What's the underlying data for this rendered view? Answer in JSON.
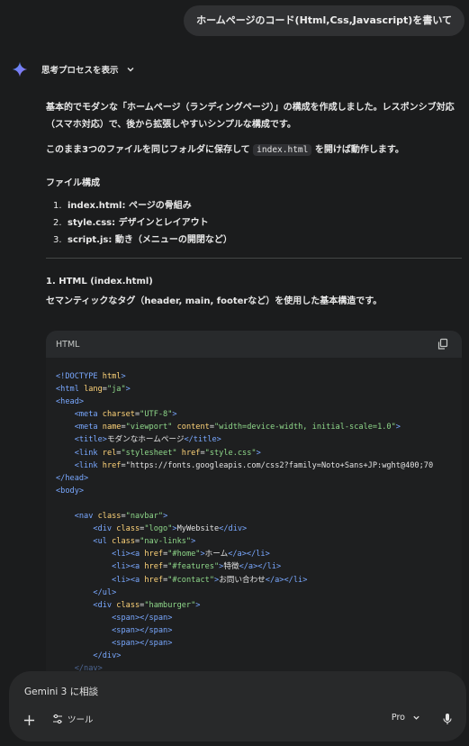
{
  "user_message": "ホームページのコード(Html,Css,Javascript)を書いて",
  "thinking": {
    "label": "思考プロセスを表示"
  },
  "answer": {
    "intro_1": "基本的でモダンな「ホームページ（ランディングページ）」の構成を作成しました。レスポンシブ対応（スマホ対応）で、後から拡張しやすいシンプルな構成です。",
    "intro_2_prefix": "このまま3つのファイルを同じフォルダに保存して",
    "intro_2_code": "index.html",
    "intro_2_suffix": "を開けば動作します。",
    "files_heading": "ファイル構成",
    "files": [
      {
        "num": "1.",
        "name": "index.html",
        "desc": ": ページの骨組み"
      },
      {
        "num": "2.",
        "name": "style.css",
        "desc": ": デザインとレイアウト"
      },
      {
        "num": "3.",
        "name": "script.js",
        "desc": ": 動き（メニューの開閉など）"
      }
    ],
    "section_1_heading": "1. HTML (index.html)",
    "section_1_desc": "セマンティックなタグ（header, main, footerなど）を使用した基本構造です。"
  },
  "code_block": {
    "language": "HTML",
    "lines": [
      "<!DOCTYPE html>",
      "<html lang=\"ja\">",
      "<head>",
      "    <meta charset=\"UTF-8\">",
      "    <meta name=\"viewport\" content=\"width=device-width, initial-scale=1.0\">",
      "    <title>モダンなホームページ</title>",
      "    <link rel=\"stylesheet\" href=\"style.css\">",
      "    <link href=\"https://fonts.googleapis.com/css2?family=Noto+Sans+JP:wght@400;70",
      "</head>",
      "<body>",
      "",
      "    <nav class=\"navbar\">",
      "        <div class=\"logo\">MyWebsite</div>",
      "        <ul class=\"nav-links\">",
      "            <li><a href=\"#home\">ホーム</a></li>",
      "            <li><a href=\"#features\">特徴</a></li>",
      "            <li><a href=\"#contact\">お問い合わせ</a></li>",
      "        </ul>",
      "        <div class=\"hamburger\">",
      "            <span></span>",
      "            <span></span>",
      "            <span></span>",
      "        </div>",
      "    </nav>"
    ]
  },
  "composer": {
    "placeholder": "Gemini 3 に相談",
    "tools_label": "ツール",
    "model_label": "Pro"
  },
  "icons": {
    "spark": "gemini-spark-icon",
    "chevron": "chevron-down-icon",
    "copy": "copy-icon",
    "plus": "plus-icon",
    "tools": "tools-icon",
    "mic": "mic-icon"
  },
  "colors": {
    "background": "#1b1c1d",
    "code_bg": "#1e1f20",
    "tag": "#79a8ff",
    "attr": "#ffd479",
    "string": "#8fd88a"
  }
}
